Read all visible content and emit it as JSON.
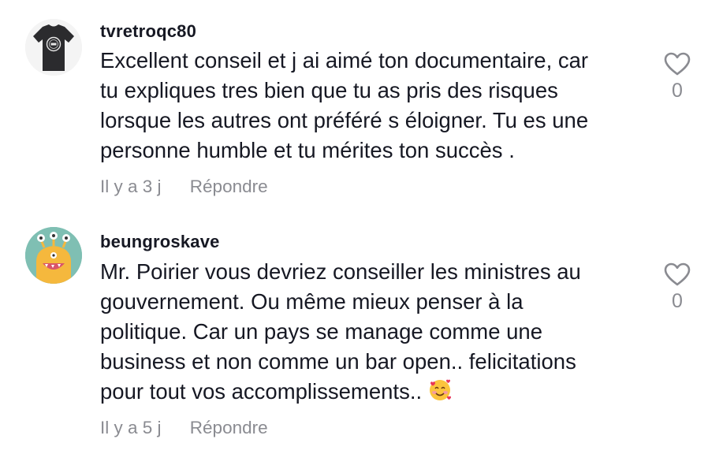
{
  "comments": [
    {
      "username": "tvretroqc80",
      "lines": [
        "Excellent conseil et j ai aimé ton documentaire, car",
        "tu expliques tres bien que tu as pris des risques",
        "lorsque les autres ont préféré s éloigner. Tu es une",
        "personne humble et tu mérites ton succès ."
      ],
      "time": "Il y a 3 j",
      "reply_label": "Répondre",
      "like_count": "0",
      "avatar_icon": "tshirt-avatar-icon"
    },
    {
      "username": "beungroskave",
      "lines": [
        "Mr. Poirier vous devriez conseiller les ministres au",
        "gouvernement. Ou même mieux penser à la",
        "politique. Car un pays se manage comme une",
        "business et non comme un bar open.. felicitations",
        "pour tout vos accomplissements.."
      ],
      "emoji": "smiling-face-with-hearts-icon",
      "time": "Il y a 5 j",
      "reply_label": "Répondre",
      "like_count": "0",
      "avatar_icon": "monster-avatar-icon"
    }
  ],
  "colors": {
    "text": "#161823",
    "muted": "#8a8b91",
    "avatar2_bg": "#7fbfb3",
    "monster": "#f5b83d"
  }
}
